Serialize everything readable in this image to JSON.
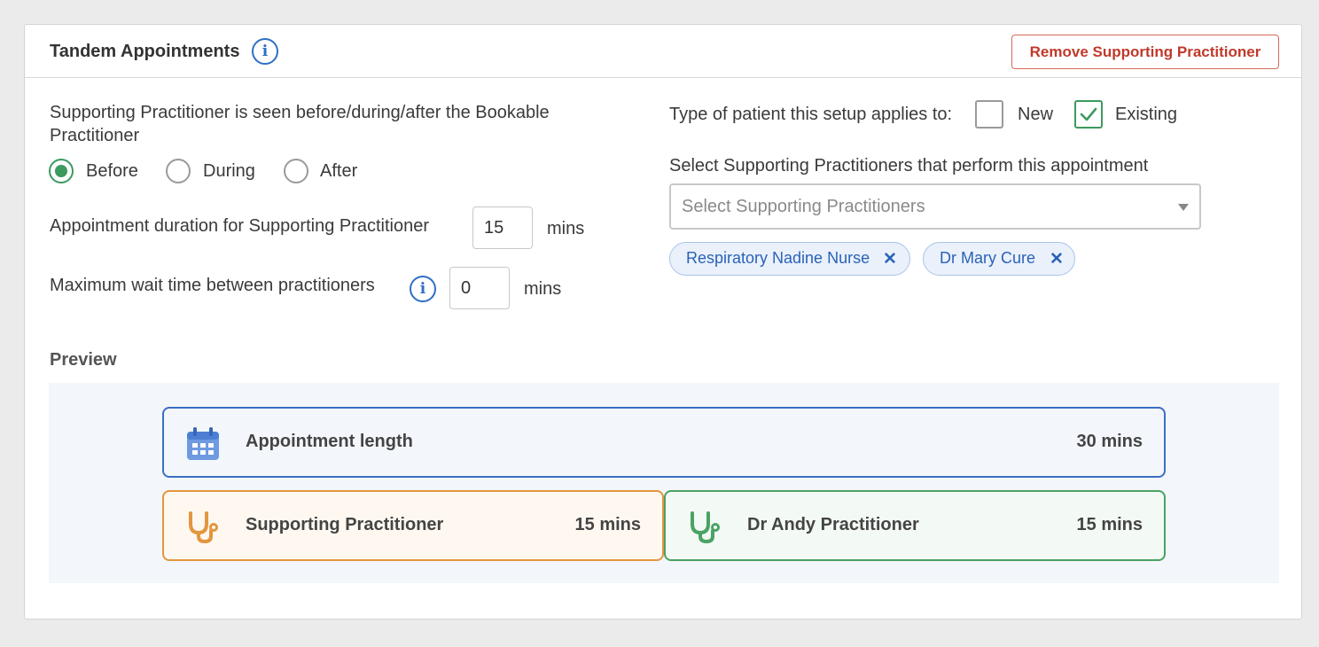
{
  "header": {
    "title": "Tandem Appointments",
    "info_icon": "info-icon",
    "remove_button_label": "Remove Supporting Practitioner"
  },
  "timing": {
    "question": "Supporting Practitioner is seen before/during/after the Bookable Practitioner",
    "options": [
      {
        "label": "Before",
        "selected": true
      },
      {
        "label": "During",
        "selected": false
      },
      {
        "label": "After",
        "selected": false
      }
    ]
  },
  "duration": {
    "label": "Appointment duration for Supporting Practitioner",
    "value": "15",
    "unit": "mins"
  },
  "max_wait": {
    "label": "Maximum wait time between practitioners",
    "value": "0",
    "unit": "mins"
  },
  "patient_type": {
    "label": "Type of patient this setup applies to:",
    "options": [
      {
        "label": "New",
        "checked": false
      },
      {
        "label": "Existing",
        "checked": true
      }
    ]
  },
  "supporting_select": {
    "label": "Select Supporting Practitioners that perform this appointment",
    "placeholder": "Select Supporting Practitioners",
    "chips": [
      {
        "label": "Respiratory Nadine Nurse"
      },
      {
        "label": "Dr Mary Cure"
      }
    ]
  },
  "preview": {
    "label": "Preview",
    "appointment": {
      "name": "Appointment length",
      "duration": "30 mins",
      "icon": "calendar-icon",
      "color": "#3a6fc3"
    },
    "supporting": {
      "name": "Supporting Practitioner",
      "duration": "15 mins",
      "icon": "stethoscope-icon",
      "color": "#e3963e"
    },
    "bookable": {
      "name": "Dr Andy Practitioner",
      "duration": "15 mins",
      "icon": "stethoscope-icon",
      "color": "#4aa264"
    }
  }
}
